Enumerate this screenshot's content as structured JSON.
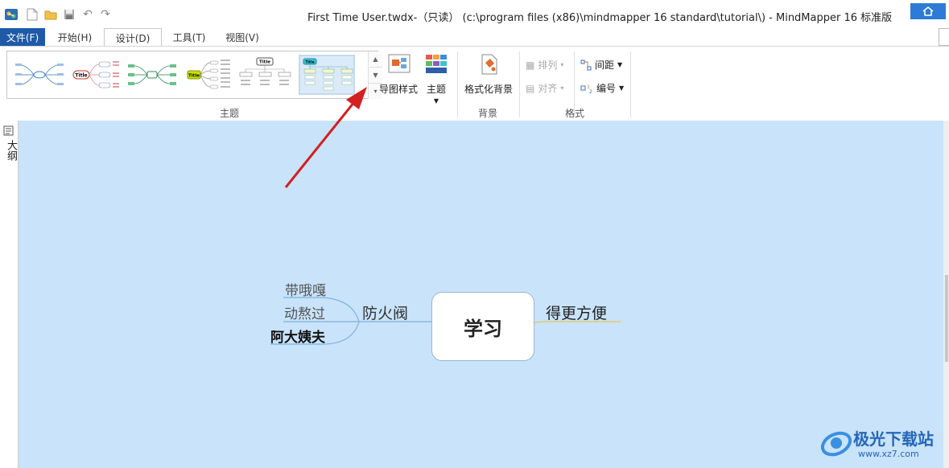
{
  "window": {
    "title": "First Time User.twdx-（只读） (c:\\program files (x86)\\mindmapper 16 standard\\tutorial\\) - MindMapper 16 标准版"
  },
  "quick_access": [
    "app-logo-icon",
    "new-file-icon",
    "open-folder-icon",
    "save-icon",
    "undo-icon",
    "redo-icon"
  ],
  "tabs": [
    {
      "label": "文件(F)"
    },
    {
      "label": "开始(H)"
    },
    {
      "label": "设计(D)"
    },
    {
      "label": "工具(T)"
    },
    {
      "label": "视图(V)"
    }
  ],
  "ribbon": {
    "theme_group_label": "主题",
    "map_style_label": "导图样式",
    "theme_label": "主题",
    "format_bg_label": "格式化背景",
    "bg_group_label": "背景",
    "arrange_label": "排列",
    "align_label": "对齐",
    "spacing_label": "间距",
    "numbering_label": "编号",
    "format_group_label": "格式",
    "thumb_title": "Title"
  },
  "side_panel": {
    "outline_label": "大纲"
  },
  "mindmap": {
    "central": "学习",
    "left_main": "防火阀",
    "left_children": [
      "带哦嘎",
      "动熬过",
      "阿大姨夫"
    ],
    "right_main": "得更方便"
  },
  "watermark": {
    "text": "极光下载站",
    "url": "www.xz7.com"
  },
  "colors": {
    "canvas_bg": "#c8e3fa",
    "accent": "#2d7bd6",
    "arrow": "#d32020",
    "branch_line": "#7fb0dc",
    "right_underline": "#e8c64a"
  }
}
